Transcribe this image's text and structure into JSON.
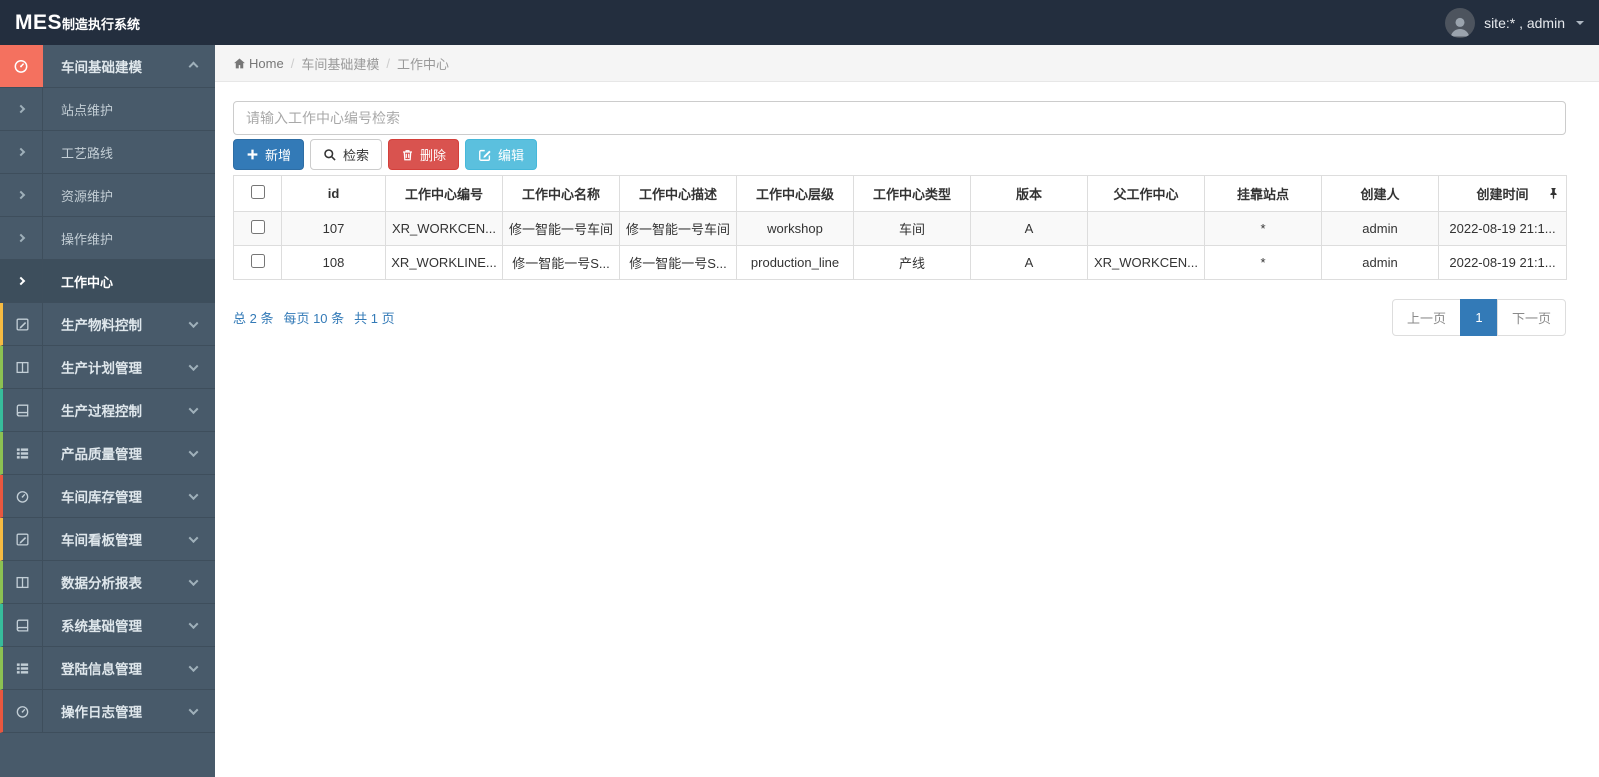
{
  "topbar": {
    "brand_bold": "MES",
    "brand_rest": "制造执行系统",
    "user_label": "site:* , admin"
  },
  "breadcrumb": {
    "home": "Home",
    "section": "车间基础建模",
    "page": "工作中心"
  },
  "search": {
    "placeholder": "请输入工作中心编号检索",
    "value": ""
  },
  "toolbar": {
    "add_label": "新增",
    "search_label": "检索",
    "delete_label": "删除",
    "edit_label": "编辑"
  },
  "sidebar": {
    "active_group": {
      "label": "车间基础建模",
      "icon": "gauge-icon",
      "state": "expanded"
    },
    "sub_items": [
      {
        "label": "站点维护"
      },
      {
        "label": "工艺路线"
      },
      {
        "label": "资源维护"
      },
      {
        "label": "操作维护"
      },
      {
        "label": "工作中心",
        "active": true
      }
    ],
    "groups": [
      {
        "label": "生产物料控制",
        "icon": "pencil-square-icon",
        "accent": "#f6bb42"
      },
      {
        "label": "生产计划管理",
        "icon": "columns-icon",
        "accent": "#8cc152"
      },
      {
        "label": "生产过程控制",
        "icon": "book-icon",
        "accent": "#37bc9b"
      },
      {
        "label": "产品质量管理",
        "icon": "th-list-icon",
        "accent": "#8cc152"
      },
      {
        "label": "车间库存管理",
        "icon": "gauge-icon",
        "accent": "#e9573f"
      },
      {
        "label": "车间看板管理",
        "icon": "pencil-square-icon",
        "accent": "#f6bb42"
      },
      {
        "label": "数据分析报表",
        "icon": "columns-icon",
        "accent": "#8cc152"
      },
      {
        "label": "系统基础管理",
        "icon": "book-icon",
        "accent": "#37bc9b"
      },
      {
        "label": "登陆信息管理",
        "icon": "th-list-icon",
        "accent": "#8cc152"
      },
      {
        "label": "操作日志管理",
        "icon": "gauge-icon",
        "accent": "#e9573f"
      }
    ]
  },
  "table": {
    "headers": [
      "id",
      "工作中心编号",
      "工作中心名称",
      "工作中心描述",
      "工作中心层级",
      "工作中心类型",
      "版本",
      "父工作中心",
      "挂靠站点",
      "创建人",
      "创建时间"
    ],
    "rows": [
      {
        "id": "107",
        "code": "XR_WORKCEN...",
        "name": "修一智能一号车间",
        "desc": "修一智能一号车间",
        "level": "workshop",
        "type": "车间",
        "version": "A",
        "parent": "",
        "station": "*",
        "creator": "admin",
        "created": "2022-08-19 21:1..."
      },
      {
        "id": "108",
        "code": "XR_WORKLINE...",
        "name": "修一智能一号S...",
        "desc": "修一智能一号S...",
        "level": "production_line",
        "type": "产线",
        "version": "A",
        "parent": "XR_WORKCEN...",
        "station": "*",
        "creator": "admin",
        "created": "2022-08-19 21:1..."
      }
    ]
  },
  "pagination": {
    "total": "总 2 条",
    "per_page": "每页 10 条",
    "pages": "共 1 页",
    "prev": "上一页",
    "current": "1",
    "next": "下一页"
  },
  "colors": {
    "topbar_bg": "#232e3e",
    "sidebar_bg": "#485a6a",
    "active_accent": "#f4715f",
    "primary_blue": "#337ab7",
    "danger_red": "#d9534f",
    "info_cyan": "#5bc0de",
    "link_blue": "#337ab7",
    "strip_palette": [
      "#f6bb42",
      "#8cc152",
      "#37bc9b",
      "#8cc152",
      "#e9573f"
    ]
  }
}
